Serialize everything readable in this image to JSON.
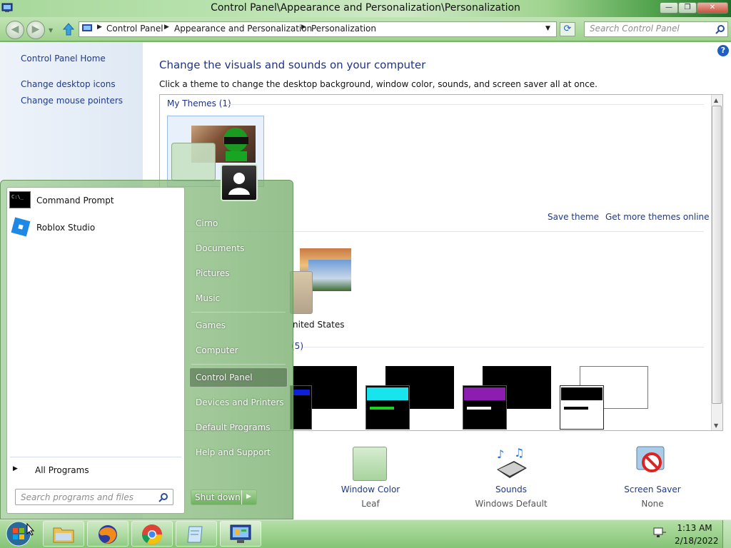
{
  "window": {
    "title": "Control Panel\\Appearance and Personalization\\Personalization",
    "minimize_glyph": "—",
    "maximize_glyph": "❐",
    "close_glyph": "✕"
  },
  "navbar": {
    "back_glyph": "◀",
    "forward_glyph": "▶",
    "breadcrumbs": [
      "Control Panel",
      "Appearance and Personalization",
      "Personalization"
    ],
    "search_placeholder": "Search Control Panel"
  },
  "left_pane": {
    "links": [
      "Control Panel Home",
      "Change desktop icons",
      "Change mouse pointers"
    ]
  },
  "main": {
    "heading": "Change the visuals and sounds on your computer",
    "subtitle": "Click a theme to change the desktop background, window color, sounds, and screen saver all at once.",
    "my_themes_label": "My Themes (1)",
    "save_theme": "Save theme",
    "get_more_themes": "Get more themes online",
    "installed_theme_partial": "nited States",
    "basic_count_partial": "(5)",
    "help_glyph": "?"
  },
  "bottom_settings": [
    {
      "label": "Window Color",
      "value": "Leaf"
    },
    {
      "label": "Sounds",
      "value": "Windows Default"
    },
    {
      "label": "Screen Saver",
      "value": "None"
    }
  ],
  "start_menu": {
    "programs": [
      "Command Prompt",
      "Roblox Studio"
    ],
    "all_programs": "All Programs",
    "search_placeholder": "Search programs and files",
    "right_items": [
      "Cirno",
      "Documents",
      "Pictures",
      "Music",
      "Games",
      "Computer",
      "Control Panel",
      "Devices and Printers",
      "Default Programs",
      "Help and Support"
    ],
    "shutdown": "Shut down"
  },
  "taskbar": {
    "time": "1:13 AM",
    "date": "2/18/2022"
  },
  "colors": {
    "link": "#1e3a8a",
    "heading": "#1e3287",
    "aero_green": "#9fd28e"
  }
}
